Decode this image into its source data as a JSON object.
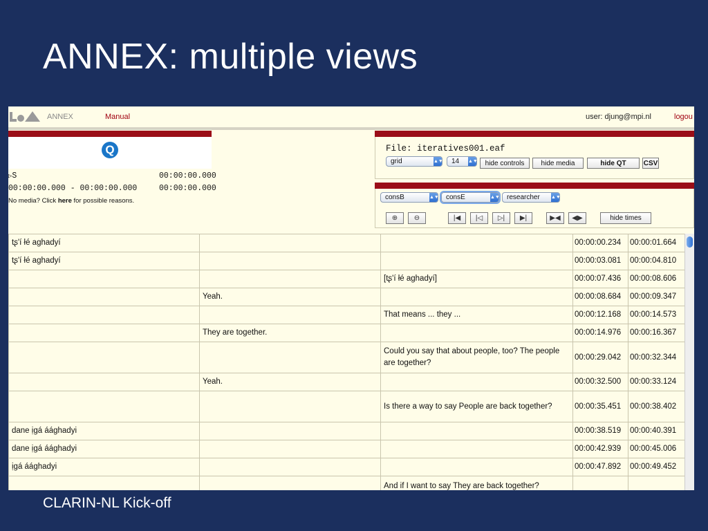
{
  "slide": {
    "title": "ANNEX: multiple views",
    "footer": "CLARIN-NL Kick-off"
  },
  "header": {
    "app_name": "ANNEX",
    "manual": "Manual",
    "user": "user: djung@mpi.nl",
    "logout": "logou"
  },
  "media": {
    "play_label": "S",
    "current_time": "00:00:00.000",
    "selection": "00:00:00.000 - 00:00:00.000",
    "selection_time": "00:00:00.000",
    "no_media_prefix": "No media? Click ",
    "no_media_link": "here",
    "no_media_suffix": " for possible reasons."
  },
  "file_panel": {
    "file_label": "File: iteratives001.eaf",
    "view_select": "grid",
    "font_size_select": "14",
    "buttons": {
      "hide_controls": "hide controls",
      "hide_media": "hide media",
      "hide_qt": "hide QT",
      "csv": "CSV"
    }
  },
  "tier_panel": {
    "tier_selects": [
      "consB",
      "consE",
      "researcher"
    ],
    "hide_times": "hide times",
    "icons": [
      "zoom-in-icon",
      "zoom-out-icon",
      "go-begin-icon",
      "step-back-icon",
      "step-forward-icon",
      "go-end-icon",
      "prev-segment-icon",
      "next-segment-icon"
    ]
  },
  "grid": {
    "rows": [
      {
        "c1": "tʂ'í łé aghadyí",
        "c2": "",
        "c3": "",
        "start": "00:00:00.234",
        "end": "00:00:01.664"
      },
      {
        "c1": "tʂ'í łé aghadyí",
        "c2": "",
        "c3": "",
        "start": "00:00:03.081",
        "end": "00:00:04.810"
      },
      {
        "c1": "",
        "c2": "",
        "c3": "[tʂ'í łé aghadyí]",
        "start": "00:00:07.436",
        "end": "00:00:08.606"
      },
      {
        "c1": "",
        "c2": "Yeah.",
        "c3": "",
        "start": "00:00:08.684",
        "end": "00:00:09.347"
      },
      {
        "c1": "",
        "c2": "",
        "c3": "That means ... they ...",
        "start": "00:00:12.168",
        "end": "00:00:14.573"
      },
      {
        "c1": "",
        "c2": "They are together.",
        "c3": "",
        "start": "00:00:14.976",
        "end": "00:00:16.367"
      },
      {
        "c1": "",
        "c2": "",
        "c3": "Could you say that about people, too? The people are together?",
        "start": "00:00:29.042",
        "end": "00:00:32.344"
      },
      {
        "c1": "",
        "c2": "Yeah.",
        "c3": "",
        "start": "00:00:32.500",
        "end": "00:00:33.124"
      },
      {
        "c1": "",
        "c2": "",
        "c3": "Is there a way to say People are back together?",
        "start": "00:00:35.451",
        "end": "00:00:38.402"
      },
      {
        "c1": "dane ịgá áághadyi",
        "c2": "",
        "c3": "",
        "start": "00:00:38.519",
        "end": "00:00:40.391"
      },
      {
        "c1": "dane ịgá áághadyi",
        "c2": "",
        "c3": "",
        "start": "00:00:42.939",
        "end": "00:00:45.006"
      },
      {
        "c1": "ịgá áághadyi",
        "c2": "",
        "c3": "",
        "start": "00:00:47.892",
        "end": "00:00:49.452"
      },
      {
        "c1": "",
        "c2": "",
        "c3": "And if I want to say They are back together?",
        "start": "",
        "end": ""
      }
    ]
  }
}
